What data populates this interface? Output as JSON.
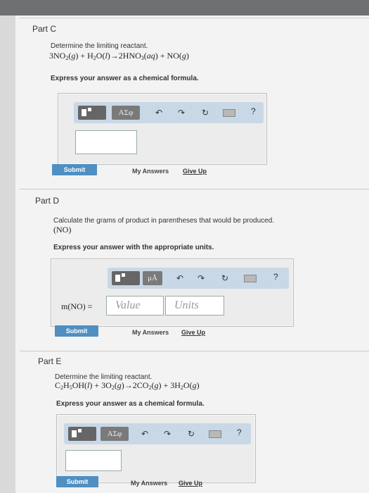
{
  "partC": {
    "title": "Part C",
    "prompt": "Determine the limiting reactant.",
    "instruction": "Express your answer as a chemical formula.",
    "symbol_button": "ΑΣφ",
    "submit": "Submit",
    "my_answers": "My Answers",
    "give_up": "Give Up"
  },
  "partD": {
    "title": "Part D",
    "prompt": "Calculate the grams of product in parentheses that would be produced.",
    "product": "(NO)",
    "instruction": "Express your answer with the appropriate units.",
    "symbol_button": "μÅ",
    "label": "m(NO) =",
    "value_placeholder": "Value",
    "units_placeholder": "Units",
    "submit": "Submit",
    "my_answers": "My Answers",
    "give_up": "Give Up"
  },
  "partE": {
    "title": "Part E",
    "prompt": "Determine the limiting reactant.",
    "instruction": "Express your answer as a chemical formula.",
    "symbol_button": "ΑΣφ",
    "submit": "Submit",
    "my_answers": "My Answers",
    "give_up": "Give Up"
  },
  "toolbar": {
    "undo": "↶",
    "redo": "↷",
    "reset": "↻",
    "help": "?",
    "icons": [
      "template-icon",
      "undo-icon",
      "redo-icon",
      "reset-icon",
      "keyboard-icon",
      "help-icon"
    ]
  },
  "colors": {
    "submit": "#4f8fc2",
    "toolbar": "#c9d8e6",
    "topbar": "#6f7072"
  }
}
